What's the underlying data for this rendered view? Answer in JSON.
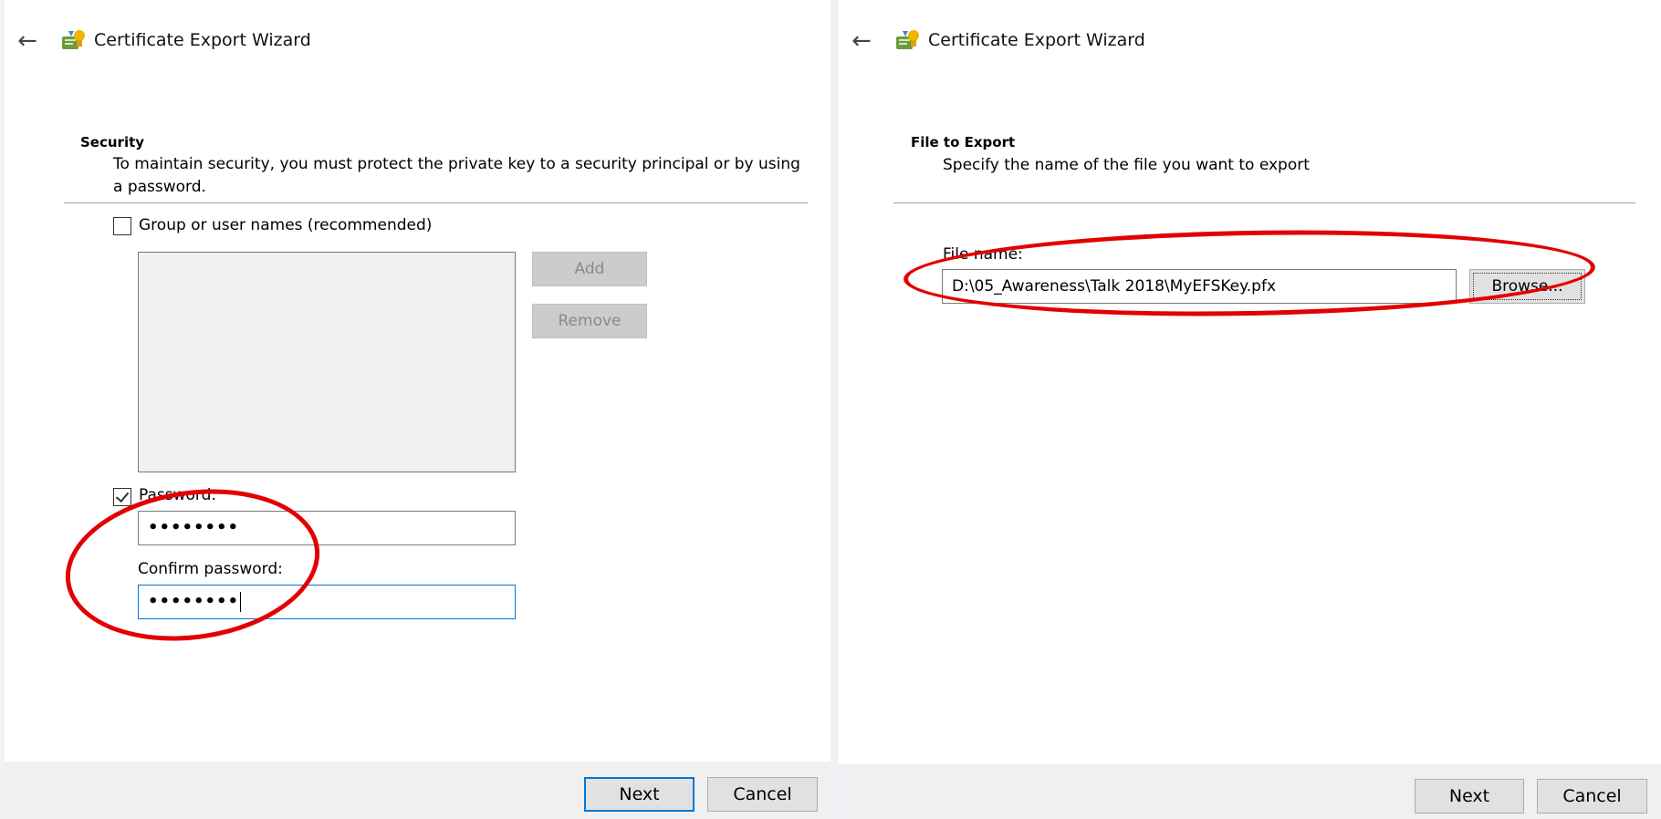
{
  "left": {
    "header": {
      "title": "Certificate Export Wizard"
    },
    "section": {
      "title": "Security",
      "description_line1": "To maintain security, you must protect the private key to a security principal or by using",
      "description_line2": "a password."
    },
    "group_option": {
      "label": "Group or user names (recommended)",
      "checked": false
    },
    "buttons": {
      "add": "Add",
      "remove": "Remove"
    },
    "password_option": {
      "label": "Password:",
      "checked": true,
      "value": "••••••••"
    },
    "confirm": {
      "label": "Confirm password:",
      "value": "••••••••"
    },
    "footer": {
      "next": "Next",
      "cancel": "Cancel"
    }
  },
  "right": {
    "header": {
      "title": "Certificate Export Wizard"
    },
    "section": {
      "title": "File to Export",
      "description": "Specify the name of the file you want to export"
    },
    "file_name": {
      "label": "File name:",
      "value": "D:\\05_Awareness\\Talk 2018\\MyEFSKey.pfx"
    },
    "browse": "Browse...",
    "footer": {
      "next": "Next",
      "cancel": "Cancel"
    }
  },
  "colors": {
    "annotation": "#e20000",
    "focus": "#0078d7",
    "background": "#eef1f6"
  },
  "icons": {
    "back": "back-arrow-icon",
    "wizard": "certificate-wizard-icon"
  }
}
